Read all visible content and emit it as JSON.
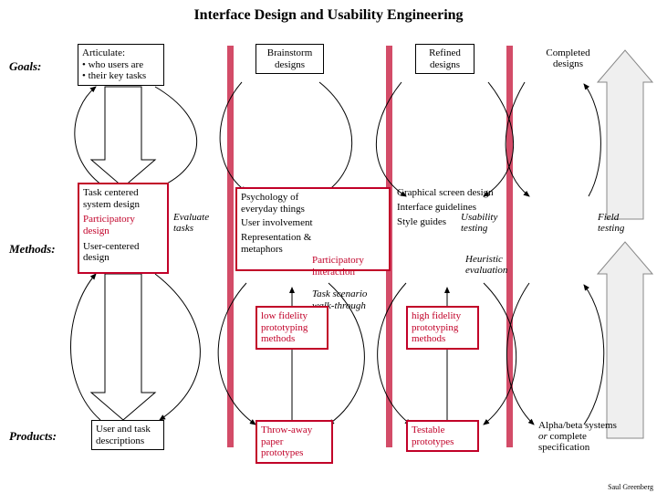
{
  "title": "Interface Design and Usability Engineering",
  "rows": {
    "goals": "Goals:",
    "methods": "Methods:",
    "products": "Products:"
  },
  "goals": {
    "articulate": {
      "line1": "Articulate:",
      "line2": "• who users are",
      "line3": "• their key tasks"
    },
    "brainstorm": {
      "line1": "Brainstorm",
      "line2": "designs"
    },
    "refined": {
      "line1": "Refined",
      "line2": "designs"
    },
    "completed": {
      "line1": "Completed",
      "line2": "designs"
    }
  },
  "methods": {
    "task_centered": "Task centered system design",
    "participatory_design": "Participatory design",
    "user_centered": "User-centered design",
    "evaluate_tasks": "Evaluate tasks",
    "psychology": "Psychology of everyday things",
    "user_involvement": "User involvement",
    "representation": "Representation & metaphors",
    "participatory_interaction": "Participatory interaction",
    "task_scenario": "Task scenario walk-through",
    "low_fidelity": "low fidelity prototyping methods",
    "graphical": "Graphical screen design",
    "interface_guidelines": "Interface guidelines",
    "style_guides": "Style guides",
    "usability_testing": "Usability testing",
    "heuristic": "Heuristic evaluation",
    "high_fidelity": "high fidelity prototyping methods",
    "field_testing": "Field testing"
  },
  "products": {
    "user_task": "User and task descriptions",
    "throwaway": "Throw-away paper prototypes",
    "testable": "Testable prototypes",
    "alphabeta": {
      "line1": "Alpha/beta",
      "line2": "systems",
      "or": "or",
      "line3": "complete",
      "line4": "specification"
    }
  },
  "credit": "Saul Greenberg"
}
